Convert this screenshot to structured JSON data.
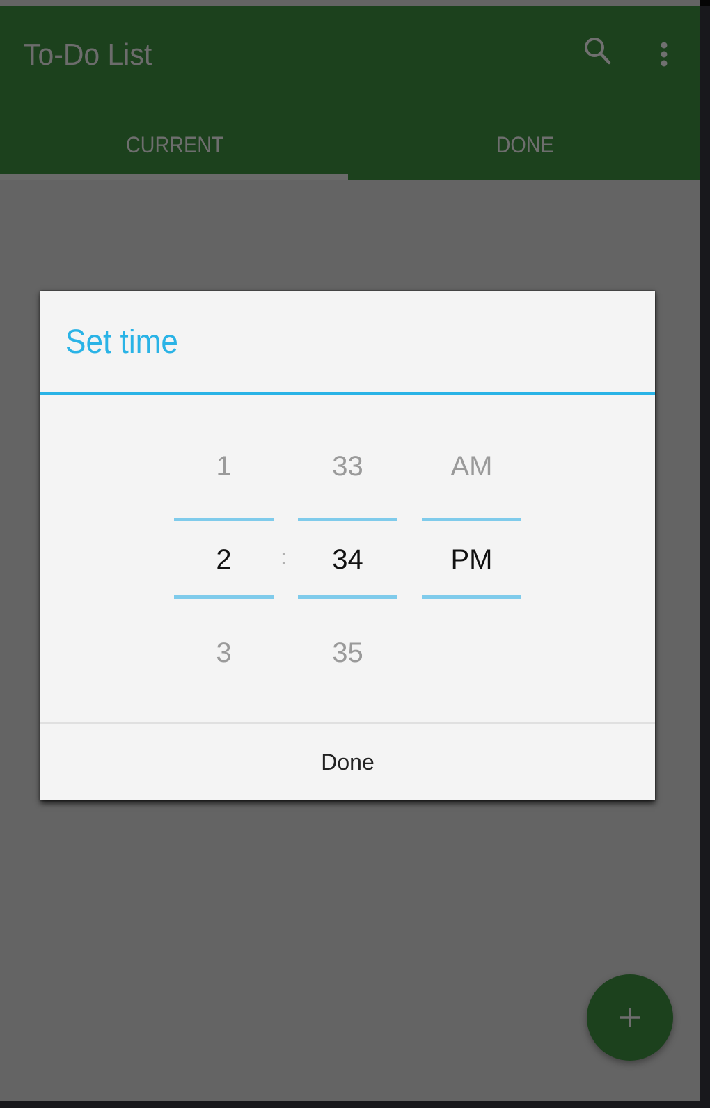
{
  "app": {
    "title": "To-Do List",
    "actions": {
      "search_icon": "search-icon",
      "more_icon": "more-vert-icon"
    }
  },
  "tabs": [
    {
      "label": "CURRENT",
      "selected": true
    },
    {
      "label": "DONE",
      "selected": false
    }
  ],
  "dialog": {
    "title": "Set time",
    "separator": ":",
    "hour": {
      "prev": "1",
      "current": "2",
      "next": "3"
    },
    "minute": {
      "prev": "33",
      "current": "34",
      "next": "35"
    },
    "ampm": {
      "prev": "AM",
      "current": "PM",
      "next": ""
    },
    "done_label": "Done"
  },
  "fab": {
    "icon": "plus-icon"
  },
  "colors": {
    "primary": "#1c411d",
    "accent": "#2ab3e6",
    "scrim": "#646464",
    "dialog_bg": "#f4f4f4"
  }
}
